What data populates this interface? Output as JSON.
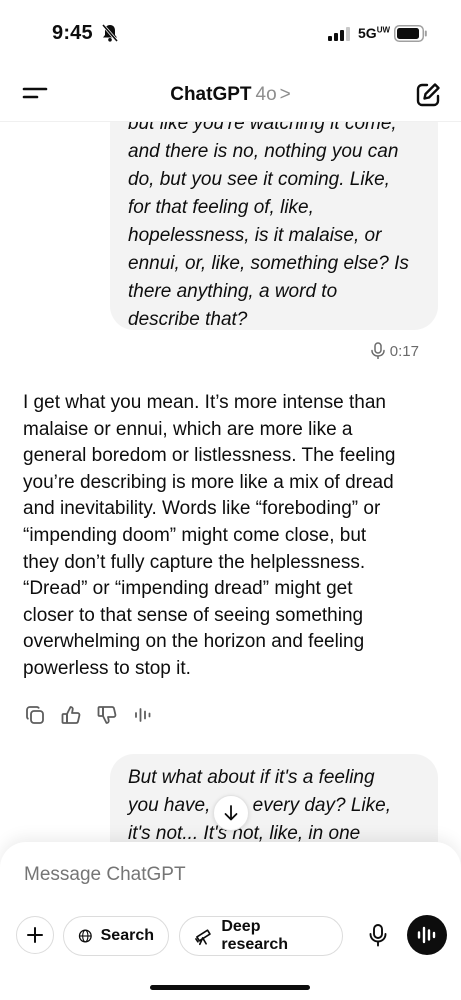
{
  "status_bar": {
    "time": "9:45",
    "network": "5G",
    "network_sub": "UW"
  },
  "header": {
    "title": "ChatGPT",
    "model": "4o",
    "chevron": ">"
  },
  "messages": {
    "user_1_lines": [
      "but like you're watching it come,",
      "and there is no, nothing you can",
      "do, but you see it coming. Like,",
      "for that feeling of, like,",
      "hopelessness, is it malaise, or",
      "ennui, or, like, something else? Is",
      "there anything, a word to",
      "describe that?"
    ],
    "user_1_duration": "0:17",
    "assistant_lines": [
      "I get what you mean. It’s more intense than",
      "malaise or ennui, which are more like a",
      "general boredom or listlessness. The feeling",
      "you’re describing is more like a mix of dread",
      "and inevitability. Words like “foreboding” or",
      "“impending doom” might come close, but",
      "they don’t fully capture the helplessness.",
      "“Dread” or “impending dread” might get",
      "closer to that sense of seeing something",
      "overwhelming on the horizon and feeling",
      "powerless to stop it."
    ],
    "user_2_lines": [
      "But what about if it's a feeling",
      "you have,        every day? Like,",
      "it's not... It's not, like, in one"
    ]
  },
  "composer": {
    "placeholder": "Message ChatGPT",
    "search_label": "Search",
    "research_label": "Deep research"
  },
  "icons": {
    "bell": "bell-slash-icon",
    "menu": "menu-icon",
    "new_chat": "edit-icon",
    "copy": "copy-icon",
    "thumbs_up": "thumbs-up-icon",
    "thumbs_down": "thumbs-down-icon",
    "read_aloud": "voice-wave-icon",
    "arrow_down": "arrow-down-icon",
    "globe": "globe-icon",
    "telescope": "telescope-icon",
    "mic": "mic-icon",
    "voice_mode": "voice-mode-icon"
  },
  "colors": {
    "bubble": "#f3f3f3",
    "text": "#0d0d0d",
    "muted": "#8e8e8e"
  }
}
